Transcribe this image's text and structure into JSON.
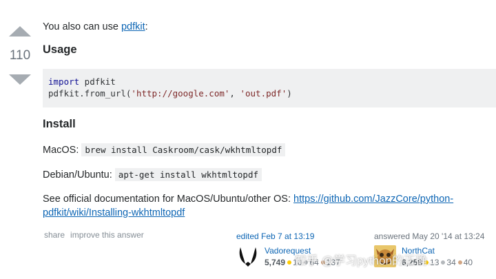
{
  "vote": {
    "count": "110"
  },
  "intro": {
    "text": "You also can use ",
    "link": "pdfkit",
    "suffix": ":"
  },
  "usage": {
    "heading": "Usage",
    "code": {
      "line1_kw": "import",
      "line1_rest": " pdfkit",
      "line2_a": "pdfkit.from_url(",
      "line2_s1": "'http://google.com'",
      "line2_b": ", ",
      "line2_s2": "'out.pdf'",
      "line2_c": ")"
    }
  },
  "install": {
    "heading": "Install",
    "mac_label": "MacOS:",
    "mac_cmd": "brew install Caskroom/cask/wkhtmltopdf",
    "debian_label": "Debian/Ubuntu:",
    "debian_cmd": "apt-get install wkhtmltopdf",
    "docs_text": "See official documentation for MacOS/Ubuntu/other OS: ",
    "docs_link_line1": "https://github.com/JazzCore/python-",
    "docs_link_line2": "pdfkit/wiki/Installing-wkhtmltopdf"
  },
  "menu": {
    "share": "share",
    "improve": "improve this answer"
  },
  "editor": {
    "action": "edited Feb 7 at 13:19",
    "name": "Vadorequest",
    "rep": "5,749",
    "gold": "10",
    "silver": "64",
    "bronze": "137"
  },
  "answerer": {
    "action": "answered May 20 '14 at 13:24",
    "name": "NorthCat",
    "rep": "6,258",
    "gold": "13",
    "silver": "34",
    "bronze": "40"
  },
  "watermark": {
    "text": "知乎 @学习python的正确..."
  },
  "colors": {
    "link": "#0c65b4",
    "code_bg": "#eff0f1",
    "vote_arrow": "#a6acb2"
  }
}
